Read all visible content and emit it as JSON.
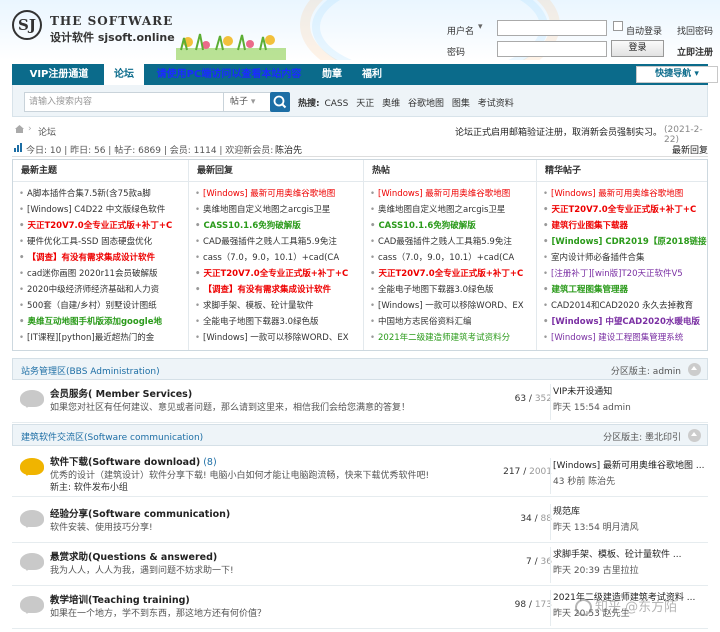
{
  "header": {
    "logo_mark": "SJ",
    "logo_title": "THE SOFTWARE",
    "logo_sub": "设计软件 sjsoft.online",
    "login": {
      "user_label": "用户名",
      "password_label": "密码",
      "auto_login_label": "自动登录",
      "forgot_label": "找回密码",
      "login_button": "登录",
      "register_link": "立即注册"
    }
  },
  "nav": {
    "items": [
      "VIP注册通道",
      "论坛",
      "请使用PC端访问以查看本站内容",
      "勋章",
      "福利"
    ],
    "quick_label": "快捷导航"
  },
  "search": {
    "placeholder": "请输入搜索内容",
    "type": "帖子",
    "hot_label": "热搜:",
    "hot_terms": [
      "CASS",
      "天正",
      "奥维",
      "谷歌地图",
      "图集",
      "考试资料"
    ]
  },
  "breadcrumb": {
    "current": "论坛",
    "notice": "论坛正式启用邮箱验证注册，取消新会员强制实习。",
    "date": "(2021-2-22)"
  },
  "stats": {
    "text": "今日: 10 | 昨日: 56 | 帖子: 6869 | 会员: 1114 | 欢迎新会员:",
    "newest_member": "陈治先",
    "latest_reply_link": "最新回复"
  },
  "hot_columns": [
    {
      "title": "最新主题",
      "items": [
        {
          "text": "A脚本插件合集7.5新(含75款a脚",
          "c": ""
        },
        {
          "text": "[Windows] C4D22 中文版绿色软件",
          "c": ""
        },
        {
          "text": "天正T20V7.0全专业正式版+补丁+C",
          "c": "red bold"
        },
        {
          "text": "硬件优化工具-SSD 固态硬盘优化",
          "c": ""
        },
        {
          "text": "【调查】有没有需求集成设计软件",
          "c": "red bold"
        },
        {
          "text": "cad迷你画图 2020r11会员破解版",
          "c": ""
        },
        {
          "text": "2020中级经济师经济基础和人力资",
          "c": ""
        },
        {
          "text": "500套（自建/乡村）别墅设计图纸",
          "c": ""
        },
        {
          "text": "奥维互动地图手机版添加google地",
          "c": "green bold"
        },
        {
          "text": "[IT课程][python]最近超热门的金",
          "c": ""
        }
      ]
    },
    {
      "title": "最新回复",
      "items": [
        {
          "text": "[Windows] 最新可用奥维谷歌地图",
          "c": "red"
        },
        {
          "text": "奥维地图自定义地图之arcgis卫星",
          "c": ""
        },
        {
          "text": "CASS10.1.6免狗破解版",
          "c": "green bold"
        },
        {
          "text": "CAD最强插件之贱人工具箱5.9免注",
          "c": ""
        },
        {
          "text": "cass（7.0，9.0，10.1）+cad(CA",
          "c": ""
        },
        {
          "text": "天正T20V7.0全专业正式版+补丁+C",
          "c": "red bold"
        },
        {
          "text": "【调查】有没有需求集成设计软件",
          "c": "red bold"
        },
        {
          "text": "求脚手架、模板、砼计量软件",
          "c": ""
        },
        {
          "text": "全能电子地图下载器3.0绿色版",
          "c": ""
        },
        {
          "text": "[Windows] 一款可以移除WORD、EX",
          "c": ""
        }
      ]
    },
    {
      "title": "热帖",
      "items": [
        {
          "text": "[Windows] 最新可用奥维谷歌地图",
          "c": "red"
        },
        {
          "text": "奥维地图自定义地图之arcgis卫星",
          "c": ""
        },
        {
          "text": "CASS10.1.6免狗破解版",
          "c": "green bold"
        },
        {
          "text": "CAD最强插件之贱人工具箱5.9免注",
          "c": ""
        },
        {
          "text": "cass（7.0，9.0，10.1）+cad(CA",
          "c": ""
        },
        {
          "text": "天正T20V7.0全专业正式版+补丁+C",
          "c": "red bold"
        },
        {
          "text": "全能电子地图下载器3.0绿色版",
          "c": ""
        },
        {
          "text": "[Windows] 一款可以移除WORD、EX",
          "c": ""
        },
        {
          "text": "中国地方志民俗资料汇编",
          "c": ""
        },
        {
          "text": "2021年二级建造师建筑考试资料分",
          "c": "green"
        }
      ]
    },
    {
      "title": "精华帖子",
      "items": [
        {
          "text": "[Windows] 最新可用奥维谷歌地图",
          "c": "red"
        },
        {
          "text": "天正T20V7.0全专业正式版+补丁+C",
          "c": "red bold"
        },
        {
          "text": "建筑行业图集下载器",
          "c": "red bold"
        },
        {
          "text": "[Windows] CDR2019【原2018链接",
          "c": "green bold"
        },
        {
          "text": "室内设计师必备插件合集",
          "c": ""
        },
        {
          "text": "[注册补丁][win版]T20天正软件V5",
          "c": "purple"
        },
        {
          "text": "建筑工程图集管理器",
          "c": "green bold"
        },
        {
          "text": "CAD2014和CAD2020 永久去掉教育",
          "c": ""
        },
        {
          "text": "[Windows] 中望CAD2020水暖电版",
          "c": "purple bold"
        },
        {
          "text": "[Windows] 建设工程图集管理系统",
          "c": "purple"
        }
      ]
    }
  ],
  "sections": [
    {
      "title": "站务管理区(BBS Administration)",
      "moderator": "分区版主: admin",
      "forums": [
        {
          "name": "会员服务( Member Services)",
          "count": "",
          "desc": "如果您对社区有任何建议、意见或者问题，那么请到这里来，相信我们会给您满意的答复！",
          "mod": "",
          "threads": "63",
          "posts": "352",
          "last_title": "VIP未开设通知",
          "last_info": "昨天 15:54 admin",
          "is_new": false
        }
      ]
    },
    {
      "title": "建筑软件交流区(Software communication)",
      "moderator": "分区版主: 墨北印引",
      "forums": [
        {
          "name": "软件下载(Software download)",
          "count": "(8)",
          "desc": "优秀的设计（建筑设计）软件分享下载! 电脑小白如何才能让电脑跑流畅，快来下载优秀软件吧!",
          "mod": "新主: 软件发布小组",
          "threads": "217",
          "posts": "2001",
          "last_title": "[Windows] 最新可用奥维谷歌地图 ...",
          "last_info": "43 秒前 陈治先",
          "is_new": true
        },
        {
          "name": "经验分享(Software communication)",
          "count": "",
          "desc": "软件安装、使用技巧分享!",
          "mod": "",
          "threads": "34",
          "posts": "88",
          "last_title": "规范库",
          "last_info": "昨天 13:54 明月清风",
          "is_new": false
        },
        {
          "name": "悬赏求助(Questions & answered)",
          "count": "",
          "desc": "我为人人，人人为我，遇到问题不妨求助一下!",
          "mod": "",
          "threads": "7",
          "posts": "36",
          "last_title": "求脚手架、模板、砼计量软件 ...",
          "last_info": "昨天 20:39 古里拉拉",
          "is_new": false
        },
        {
          "name": "教学培训(Teaching training)",
          "count": "",
          "desc": "如果在一个地方，学不到东西，那这地方还有何价值？",
          "mod": "",
          "threads": "98",
          "posts": "173",
          "last_title": "2021年二级建造师建筑考试资料 ...",
          "last_info": "昨天 20:53 赵先生",
          "is_new": false
        }
      ]
    }
  ],
  "watermark": "知乎 @东方陌",
  "colors": {
    "nav_bg": "#0b6b8b",
    "link_blue": "#1d6ea5",
    "hot_red": "#e00000",
    "hot_green": "#2a9a1a"
  }
}
